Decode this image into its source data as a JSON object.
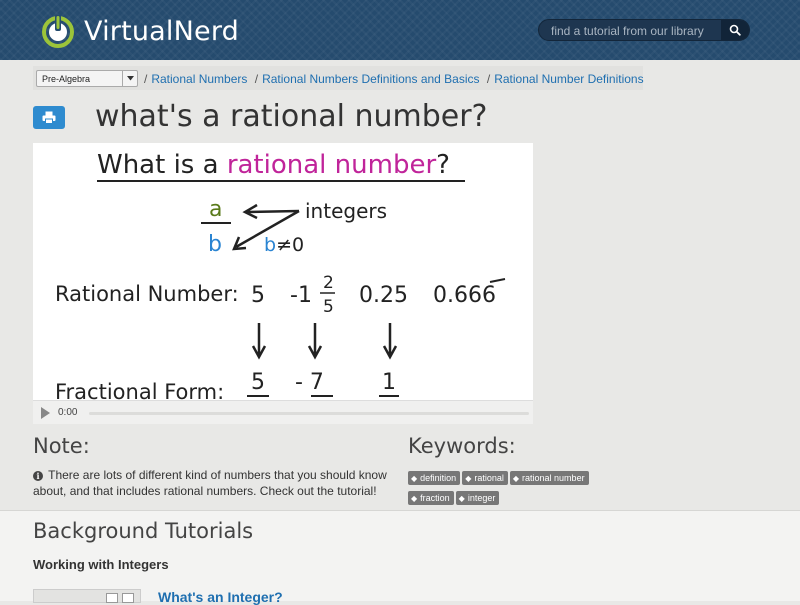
{
  "header": {
    "brand_first": "Virtual",
    "brand_second": "Nerd",
    "search_placeholder": "find a tutorial from our library",
    "bg_color": "#254b6e"
  },
  "breadcrumb": {
    "subject_selected": "Pre-Algebra",
    "items": [
      "Rational Numbers",
      "Rational Numbers Definitions and Basics",
      "Rational Number Definitions"
    ]
  },
  "page": {
    "title": "what's a rational number?"
  },
  "video": {
    "board": {
      "heading_prefix": "What is a ",
      "heading_highlight": "rational number",
      "heading_suffix": "?",
      "numerator": "a",
      "denominator": "b",
      "integers_label": "integers",
      "condition_b": "b",
      "condition_rest": "≠0",
      "rational_label": "Rational Number:",
      "example_1": "5",
      "example_2_whole": "-1",
      "example_2_num": "2",
      "example_2_den": "5",
      "example_3": "0.25",
      "example_4_prefix": "0.66",
      "example_4_repeat": "6",
      "fractional_label": "Fractional Form:",
      "frac_1": "5",
      "frac_2": "- 7",
      "frac_3": "1"
    },
    "time": "0:00",
    "progress": 0
  },
  "note": {
    "heading": "Note:",
    "text": "There are lots of different kind of numbers that you should know about, and that includes rational numbers. Check out the tutorial!"
  },
  "keywords": {
    "heading": "Keywords:",
    "tags": [
      "definition",
      "rational",
      "rational number",
      "fraction",
      "integer"
    ]
  },
  "background": {
    "heading": "Background Tutorials",
    "group_title": "Working with Integers",
    "tutorial_link": "What's an Integer?"
  },
  "colors": {
    "link": "#1f6fb0",
    "print_button": "#2e8bcf",
    "highlight_purple": "#c0249a",
    "numerator_green": "#5a7a1a",
    "denominator_blue": "#2a84d2"
  }
}
